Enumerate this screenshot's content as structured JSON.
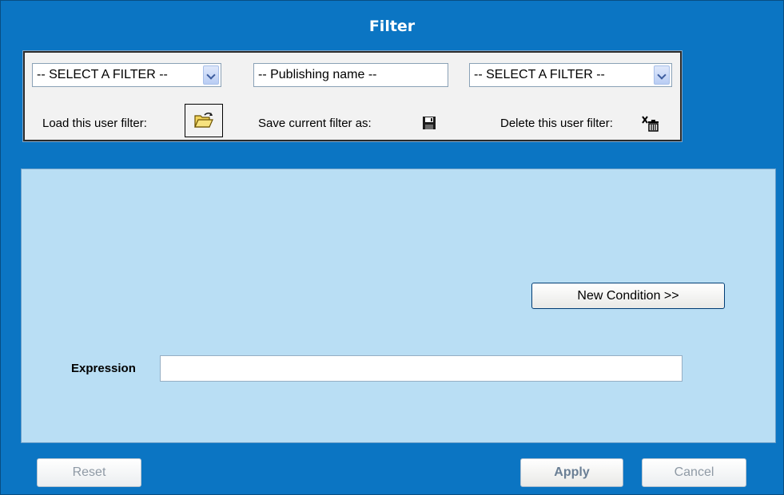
{
  "window": {
    "title": "Filter"
  },
  "toolbar": {
    "filter_select_value": "-- SELECT A FILTER --",
    "publishing_name_value": "-- Publishing name --",
    "delete_select_value": "-- SELECT A FILTER --",
    "load_label": "Load this user filter:",
    "save_label": "Save current filter as:",
    "delete_label": "Delete this user filter:",
    "load_icon": "open-folder-icon",
    "save_icon": "floppy-disk-icon",
    "delete_icon": "trash-icon"
  },
  "panel": {
    "new_condition_label": "New Condition >>",
    "expression_label": "Expression",
    "expression_value": ""
  },
  "footer": {
    "reset_label": "Reset",
    "apply_label": "Apply",
    "cancel_label": "Cancel"
  },
  "colors": {
    "window_bg": "#0b75c3",
    "panel_bg": "#b9def4",
    "toolbar_bg": "#f2f2f2"
  }
}
